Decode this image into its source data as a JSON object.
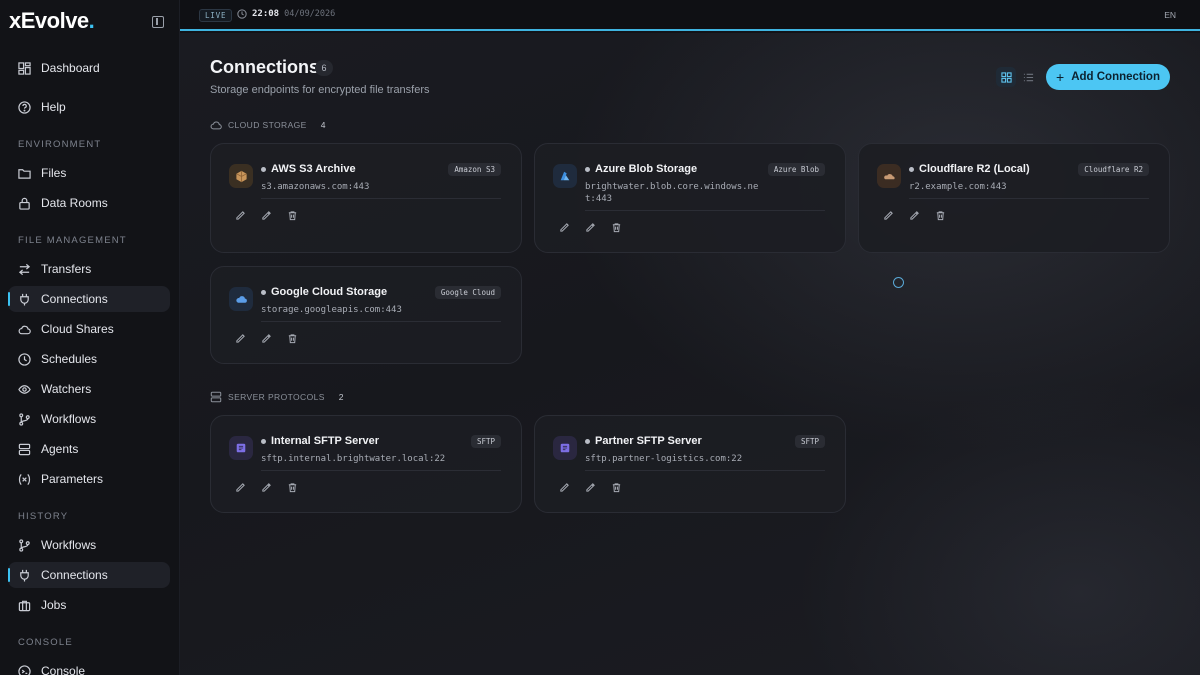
{
  "brand": {
    "name": "xEvolve",
    "dot": "."
  },
  "topbar": {
    "live": "LIVE",
    "time": "22:08",
    "date": "04/09/2026",
    "lang": "EN"
  },
  "sidebar": {
    "top": [
      {
        "label": "Dashboard",
        "icon": "dashboard-icon"
      },
      {
        "label": "Help",
        "icon": "help-icon"
      }
    ],
    "sections": {
      "environment": "ENVIRONMENT",
      "file_management": "FILE MANAGEMENT",
      "history": "HISTORY",
      "console": "CONSOLE"
    },
    "environment": [
      {
        "label": "Files",
        "icon": "folder-icon"
      },
      {
        "label": "Data Rooms",
        "icon": "lock-icon"
      }
    ],
    "file_management": [
      {
        "label": "Transfers",
        "icon": "transfer-icon"
      },
      {
        "label": "Connections",
        "icon": "plug-icon",
        "active": true
      },
      {
        "label": "Cloud Shares",
        "icon": "cloud-icon"
      },
      {
        "label": "Schedules",
        "icon": "clock-icon"
      },
      {
        "label": "Watchers",
        "icon": "eye-icon"
      },
      {
        "label": "Workflows",
        "icon": "workflow-icon"
      },
      {
        "label": "Agents",
        "icon": "server-icon"
      },
      {
        "label": "Parameters",
        "icon": "variable-icon"
      }
    ],
    "history": [
      {
        "label": "Workflows",
        "icon": "workflow-icon"
      },
      {
        "label": "Connections",
        "icon": "plug-icon",
        "active": true
      },
      {
        "label": "Jobs",
        "icon": "briefcase-icon"
      }
    ],
    "console": [
      {
        "label": "Console",
        "icon": "console-icon"
      }
    ]
  },
  "page": {
    "title": "Connections",
    "count": "6",
    "subtitle": "Storage endpoints for encrypted file transfers",
    "add_button": "Add Connection"
  },
  "groups": {
    "cloud": {
      "label": "CLOUD STORAGE",
      "count": "4"
    },
    "server": {
      "label": "SERVER PROTOCOLS",
      "count": "2"
    }
  },
  "cards": [
    {
      "name": "AWS S3 Archive",
      "badge": "Amazon S3",
      "host": "s3.amazonaws.com:443",
      "logo_color": "#3a2f22"
    },
    {
      "name": "Azure Blob Storage",
      "badge": "Azure Blob",
      "host_line1": "brightwater.blob.core.windows.ne",
      "host_line2": "t:443",
      "logo_color": "#1f2b3d"
    },
    {
      "name": "Cloudflare R2 (Local)",
      "badge": "Cloudflare R2",
      "host": "r2.example.com:443",
      "logo_color": "#3b2c22"
    },
    {
      "name": "Google Cloud Storage",
      "badge": "Google Cloud",
      "host": "storage.googleapis.com:443",
      "logo_color": "#1f2b3d"
    },
    {
      "name": "Internal SFTP Server",
      "badge": "SFTP",
      "host": "sftp.internal.brightwater.local:22",
      "logo_color": "#2a2740"
    },
    {
      "name": "Partner SFTP Server",
      "badge": "SFTP",
      "host": "sftp.partner-logistics.com:22",
      "logo_color": "#2a2740"
    }
  ]
}
